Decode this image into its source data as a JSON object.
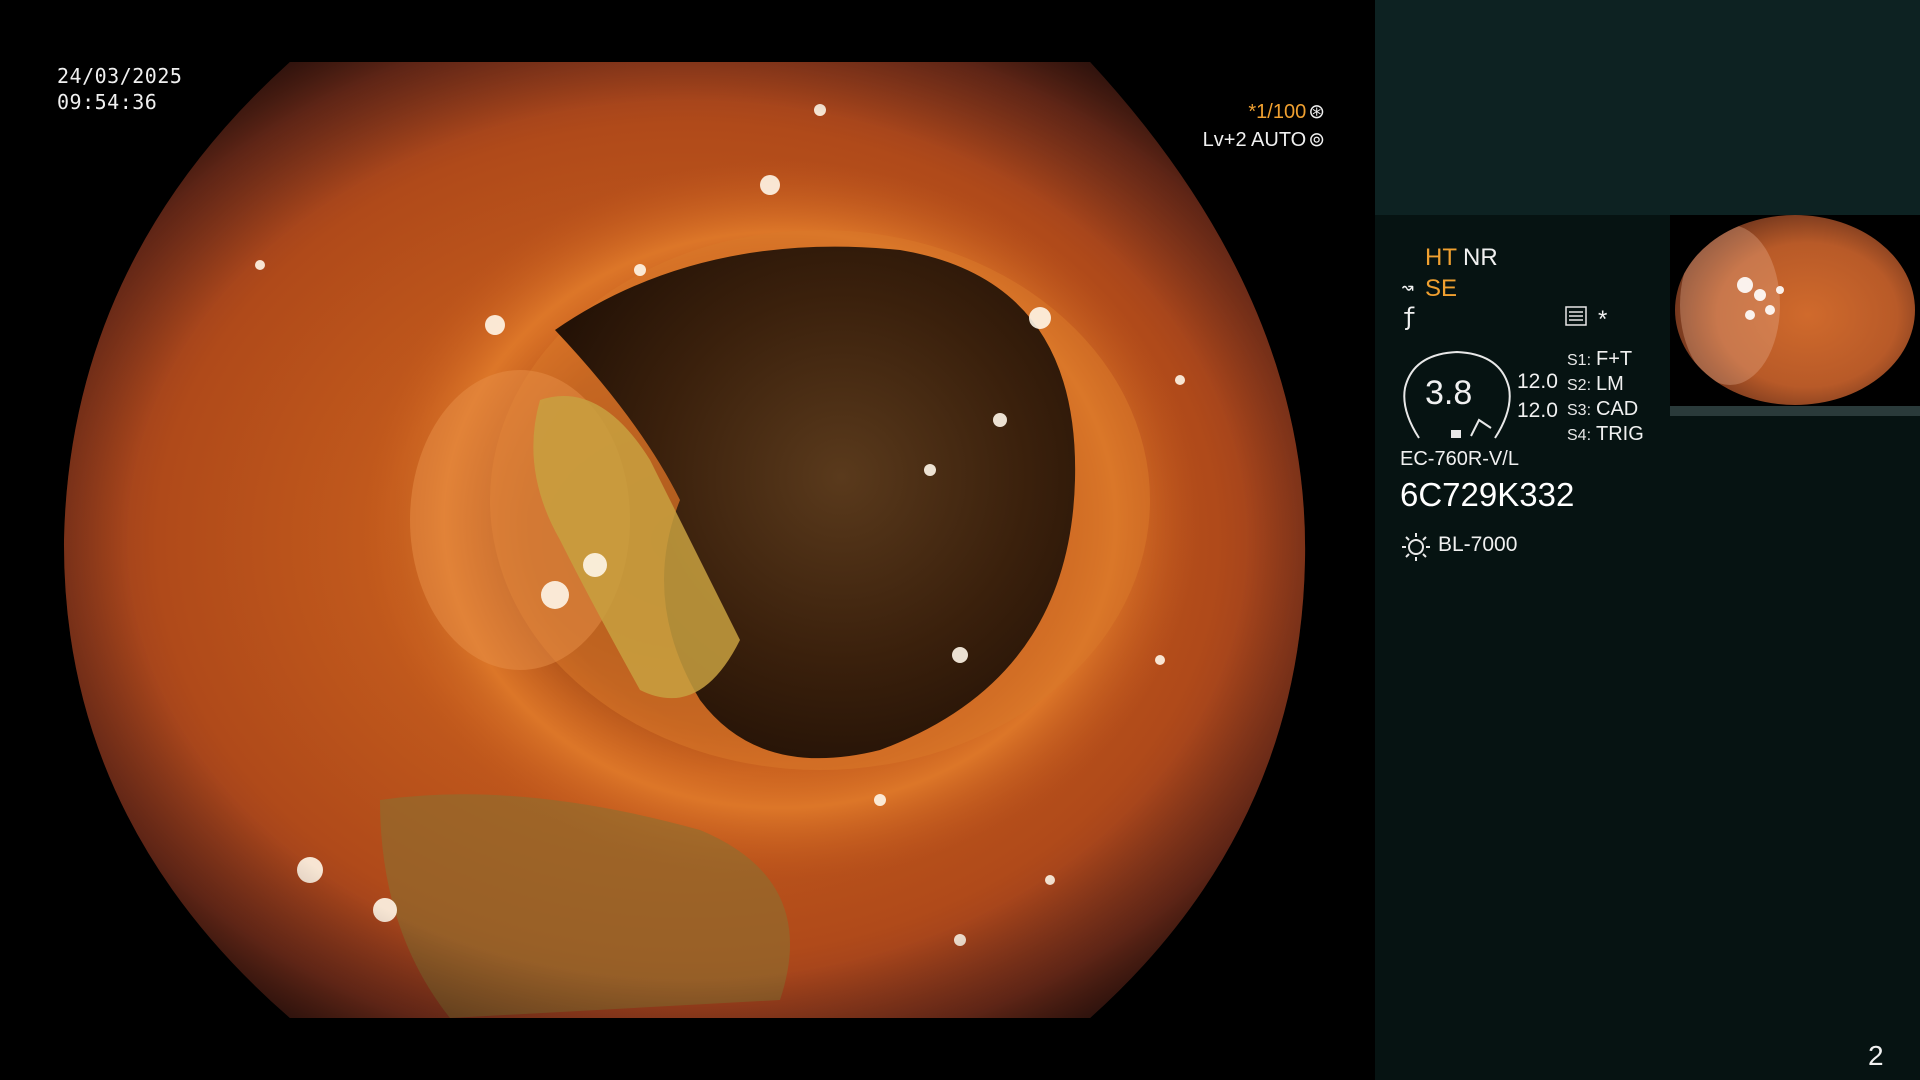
{
  "overlay": {
    "date": "24/03/2025",
    "time": "09:54:36",
    "shutter": "*1/100",
    "shutter_icon": "aperture-icon",
    "level": "Lv+2 AUTO",
    "level_icon": "iris-icon"
  },
  "panel": {
    "mode_ht": "HT",
    "mode_nr": "NR",
    "mode_se": "SE",
    "mode_se_icon": "tilde-arrow-icon",
    "freeze_icon": "f-hook-icon",
    "menu_icon": "list-menu-icon",
    "star": "*",
    "gauge_value": "3.8",
    "value_1": "12.0",
    "value_2": "12.0",
    "switches": [
      {
        "label": "S1:",
        "value": "F+T"
      },
      {
        "label": "S2:",
        "value": "LM"
      },
      {
        "label": "S3:",
        "value": "CAD"
      },
      {
        "label": "S4:",
        "value": "TRIG"
      }
    ],
    "scope_model": "EC-760R-V/L",
    "scope_serial": "6C729K332",
    "light_icon": "light-source-icon",
    "light_source": "BL-7000",
    "page_number": "2"
  },
  "colors": {
    "accent_orange": "#f0a030",
    "panel_bg": "#061312",
    "panel_top_bg": "#0d2222"
  }
}
